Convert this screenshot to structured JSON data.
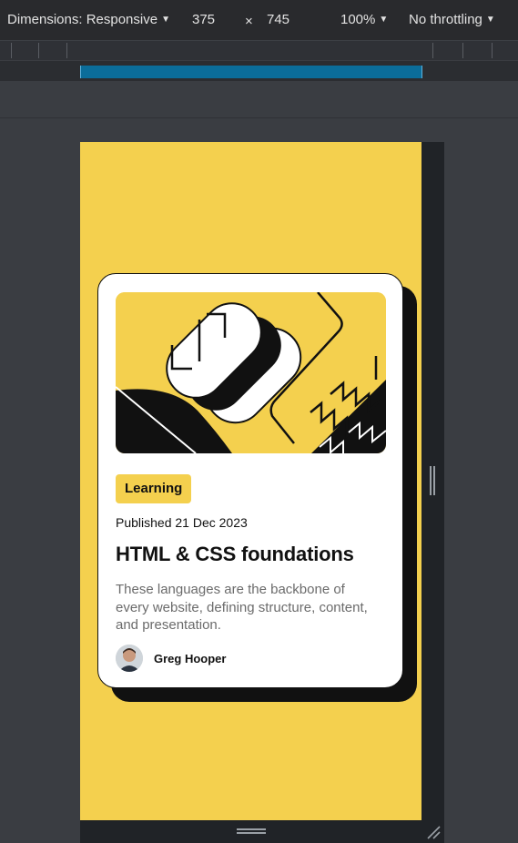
{
  "toolbar": {
    "dimensions_label": "Dimensions: Responsive",
    "width": "375",
    "times": "×",
    "height": "745",
    "zoom": "100%",
    "throttling": "No throttling"
  },
  "card": {
    "tag": "Learning",
    "published": "Published 21 Dec 2023",
    "title": "HTML & CSS foundations",
    "description": "These languages are the backbone of every website, defining structure, content, and presentation.",
    "author": "Greg Hooper"
  },
  "colors": {
    "accent_yellow": "#f4d04e",
    "ink": "#111111",
    "muted_text": "#6b6b6b",
    "devtools_bg": "#3a3d42",
    "media_query_blue": "#0b6d9a"
  },
  "icons": {
    "dropdown": "caret-down-icon",
    "resize": "resize-corner-icon"
  }
}
